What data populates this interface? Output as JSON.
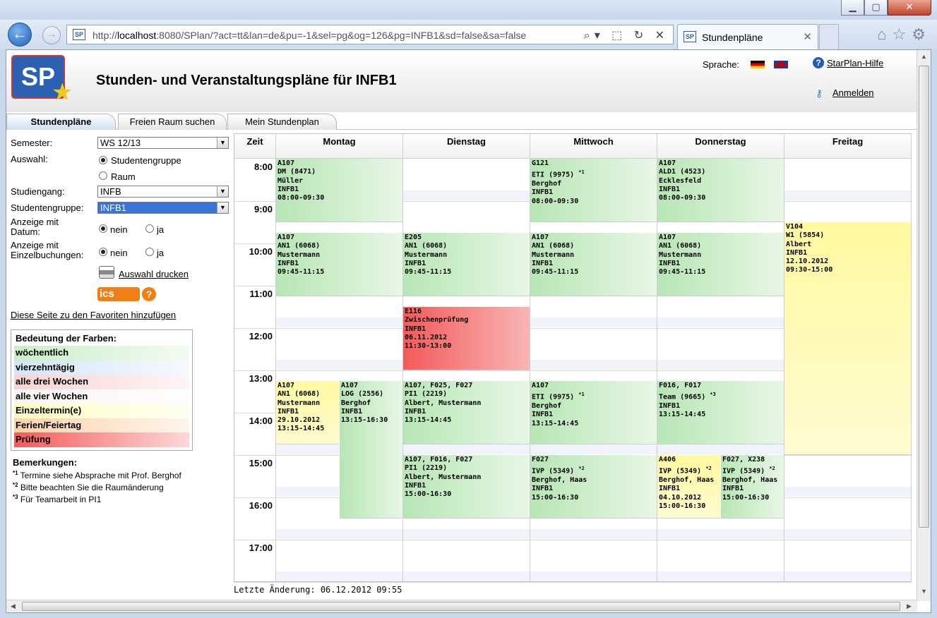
{
  "browser": {
    "url_prefix": "http://",
    "url_host": "localhost",
    "url_rest": ":8080/SPlan/?act=tt&lan=de&pu=-1&sel=pg&og=126&pg=INFB1&sd=false&sa=false",
    "tab_title": "Stundenpläne",
    "favicon_text": "SP",
    "window_buttons": [
      "▁",
      "▢",
      "✕"
    ],
    "address_icons": "⌕▾ ⬚ ↻ ✕",
    "tools_icons": "⌂☆⚙"
  },
  "header": {
    "logo_text": "SP",
    "title": "Stunden- und Veranstaltungspläne für INFB1",
    "language_label": "Sprache:",
    "help_label": "StarPlan-Hilfe",
    "login_label": "Anmelden"
  },
  "tabs": [
    "Stundenpläne",
    "Freien Raum suchen",
    "Mein Stundenplan"
  ],
  "sidebar": {
    "semester_label": "Semester:",
    "semester_value": "WS 12/13",
    "selection_label": "Auswahl:",
    "option_group": "Studentengruppe",
    "option_room": "Raum",
    "course_label": "Studiengang:",
    "course_value": "INFB",
    "group_label": "Studentengruppe:",
    "group_value": "INFB1",
    "date_label_1": "Anzeige mit",
    "date_label_2": "Datum:",
    "single_label_1": "Anzeige mit",
    "single_label_2": "Einzelbuchungen:",
    "no": "nein",
    "yes": "ja",
    "print_label": "Auswahl drucken",
    "ics_label": "ics",
    "ics_help": "?",
    "favorites_label": "Diese Seite zu den Favoriten hinzufügen"
  },
  "legend": {
    "title": "Bedeutung der Farben:",
    "items": [
      {
        "label": "wöchentlich",
        "color": "#c9eec7"
      },
      {
        "label": "vierzehntägig",
        "color": "#d3e6f9"
      },
      {
        "label": "alle drei Wochen",
        "color": "#f8d3d3"
      },
      {
        "label": "alle vier Wochen",
        "color": "#fbf5f5"
      },
      {
        "label": "Einzeltermin(e)",
        "color": "#fdfcc1"
      },
      {
        "label": "Ferien/Feiertag",
        "color": "#fbd3aa"
      },
      {
        "label": "Prüfung",
        "color": "#f35a5a"
      }
    ]
  },
  "notes": {
    "title": "Bemerkungen:",
    "items": [
      {
        "mark": "*1",
        "text": " Termine siehe Absprache mit Prof. Berghof"
      },
      {
        "mark": "*2",
        "text": " Bitte beachten Sie die Raumänderung"
      },
      {
        "mark": "*3",
        "text": " Für Teamarbeit in PI1"
      }
    ]
  },
  "timetable": {
    "time_header": "Zeit",
    "days": [
      "Montag",
      "Dienstag",
      "Mittwoch",
      "Donnerstag",
      "Freitag"
    ],
    "hours": [
      "8:00",
      "9:00",
      "10:00",
      "11:00",
      "12:00",
      "13:00",
      "14:00",
      "15:00",
      "16:00",
      "17:00"
    ],
    "events": [
      {
        "day": 0,
        "slot": 0,
        "of": 1,
        "start": "08:00",
        "end": "09:30",
        "kind": "weekly",
        "lines": [
          "A107",
          "DM (8471)",
          "Müller",
          "INFB1",
          "08:00-09:30"
        ]
      },
      {
        "day": 2,
        "slot": 0,
        "of": 1,
        "start": "08:00",
        "end": "09:30",
        "kind": "weekly",
        "lines": [
          "G121",
          "ETI (9975)",
          "Berghof",
          "INFB1",
          "08:00-09:30"
        ],
        "mark": "*1",
        "mark_line": 1
      },
      {
        "day": 3,
        "slot": 0,
        "of": 1,
        "start": "08:00",
        "end": "09:30",
        "kind": "weekly",
        "lines": [
          "A107",
          "ALD1 (4523)",
          "Ecklesfeld",
          "INFB1",
          "08:00-09:30"
        ]
      },
      {
        "day": 0,
        "slot": 0,
        "of": 1,
        "start": "09:45",
        "end": "11:15",
        "kind": "weekly",
        "lines": [
          "A107",
          "AN1 (6068)",
          "Mustermann",
          "INFB1",
          "09:45-11:15"
        ]
      },
      {
        "day": 1,
        "slot": 0,
        "of": 1,
        "start": "09:45",
        "end": "11:15",
        "kind": "weekly",
        "lines": [
          "E205",
          "AN1 (6068)",
          "Mustermann",
          "INFB1",
          "09:45-11:15"
        ]
      },
      {
        "day": 2,
        "slot": 0,
        "of": 1,
        "start": "09:45",
        "end": "11:15",
        "kind": "weekly",
        "lines": [
          "A107",
          "AN1 (6068)",
          "Mustermann",
          "INFB1",
          "09:45-11:15"
        ]
      },
      {
        "day": 3,
        "slot": 0,
        "of": 1,
        "start": "09:45",
        "end": "11:15",
        "kind": "weekly",
        "lines": [
          "A107",
          "AN1 (6068)",
          "Mustermann",
          "INFB1",
          "09:45-11:15"
        ]
      },
      {
        "day": 4,
        "slot": 0,
        "of": 1,
        "start": "09:30",
        "end": "15:00",
        "kind": "single",
        "lines": [
          "V104",
          "W1 (5854)",
          "Albert",
          "INFB1",
          "12.10.2012",
          "09:30-15:00"
        ]
      },
      {
        "day": 1,
        "slot": 0,
        "of": 1,
        "start": "11:30",
        "end": "13:00",
        "kind": "exam",
        "lines": [
          "E116",
          "Zwischenprüfung",
          "INFB1",
          "06.11.2012",
          "11:30-13:00"
        ]
      },
      {
        "day": 0,
        "slot": 0,
        "of": 2,
        "start": "13:15",
        "end": "14:45",
        "kind": "single",
        "lines": [
          "A107",
          "AN1 (6068)",
          "Mustermann",
          "INFB1",
          "29.10.2012",
          "13:15-14:45"
        ]
      },
      {
        "day": 0,
        "slot": 1,
        "of": 2,
        "start": "13:15",
        "end": "16:30",
        "kind": "weekly",
        "lines": [
          "A107",
          "LOG (2556)",
          "Berghof",
          "INFB1",
          "13:15-16:30"
        ]
      },
      {
        "day": 1,
        "slot": 0,
        "of": 1,
        "start": "13:15",
        "end": "14:45",
        "kind": "weekly",
        "lines": [
          "A107, F025, F027",
          "PI1 (2219)",
          "Albert, Mustermann",
          "INFB1",
          "13:15-14:45"
        ]
      },
      {
        "day": 2,
        "slot": 0,
        "of": 1,
        "start": "13:15",
        "end": "14:45",
        "kind": "weekly",
        "lines": [
          "A107",
          "ETI (9975)",
          "Berghof",
          "INFB1",
          "13:15-14:45"
        ],
        "mark": "*1",
        "mark_line": 1
      },
      {
        "day": 3,
        "slot": 0,
        "of": 1,
        "start": "13:15",
        "end": "14:45",
        "kind": "weekly",
        "lines": [
          "F016, F017",
          "Team (9665)",
          "INFB1",
          "13:15-14:45"
        ],
        "mark": "*3",
        "mark_line": 1
      },
      {
        "day": 1,
        "slot": 0,
        "of": 1,
        "start": "15:00",
        "end": "16:30",
        "kind": "weekly",
        "lines": [
          "A107, F016, F027",
          "PI1 (2219)",
          "Albert, Mustermann",
          "INFB1",
          "15:00-16:30"
        ]
      },
      {
        "day": 2,
        "slot": 0,
        "of": 1,
        "start": "15:00",
        "end": "16:30",
        "kind": "weekly",
        "lines": [
          "F027",
          "IVP (5349)",
          "Berghof, Haas",
          "INFB1",
          "15:00-16:30"
        ],
        "mark": "*2",
        "mark_line": 1
      },
      {
        "day": 3,
        "slot": 0,
        "of": 2,
        "start": "15:00",
        "end": "16:30",
        "kind": "single",
        "lines": [
          "A406",
          "IVP (5349)",
          "Berghof, Haas",
          "INFB1",
          "04.10.2012",
          "15:00-16:30"
        ],
        "mark": "*2",
        "mark_line": 1
      },
      {
        "day": 3,
        "slot": 1,
        "of": 2,
        "start": "15:00",
        "end": "16:30",
        "kind": "weekly",
        "lines": [
          "F027, X238",
          "IVP (5349)",
          "Berghof, Haas",
          "INFB1",
          "15:00-16:30"
        ],
        "mark": "*2",
        "mark_line": 1
      }
    ]
  },
  "footer": {
    "last_change": "Letzte Änderung: 06.12.2012 09:55"
  }
}
